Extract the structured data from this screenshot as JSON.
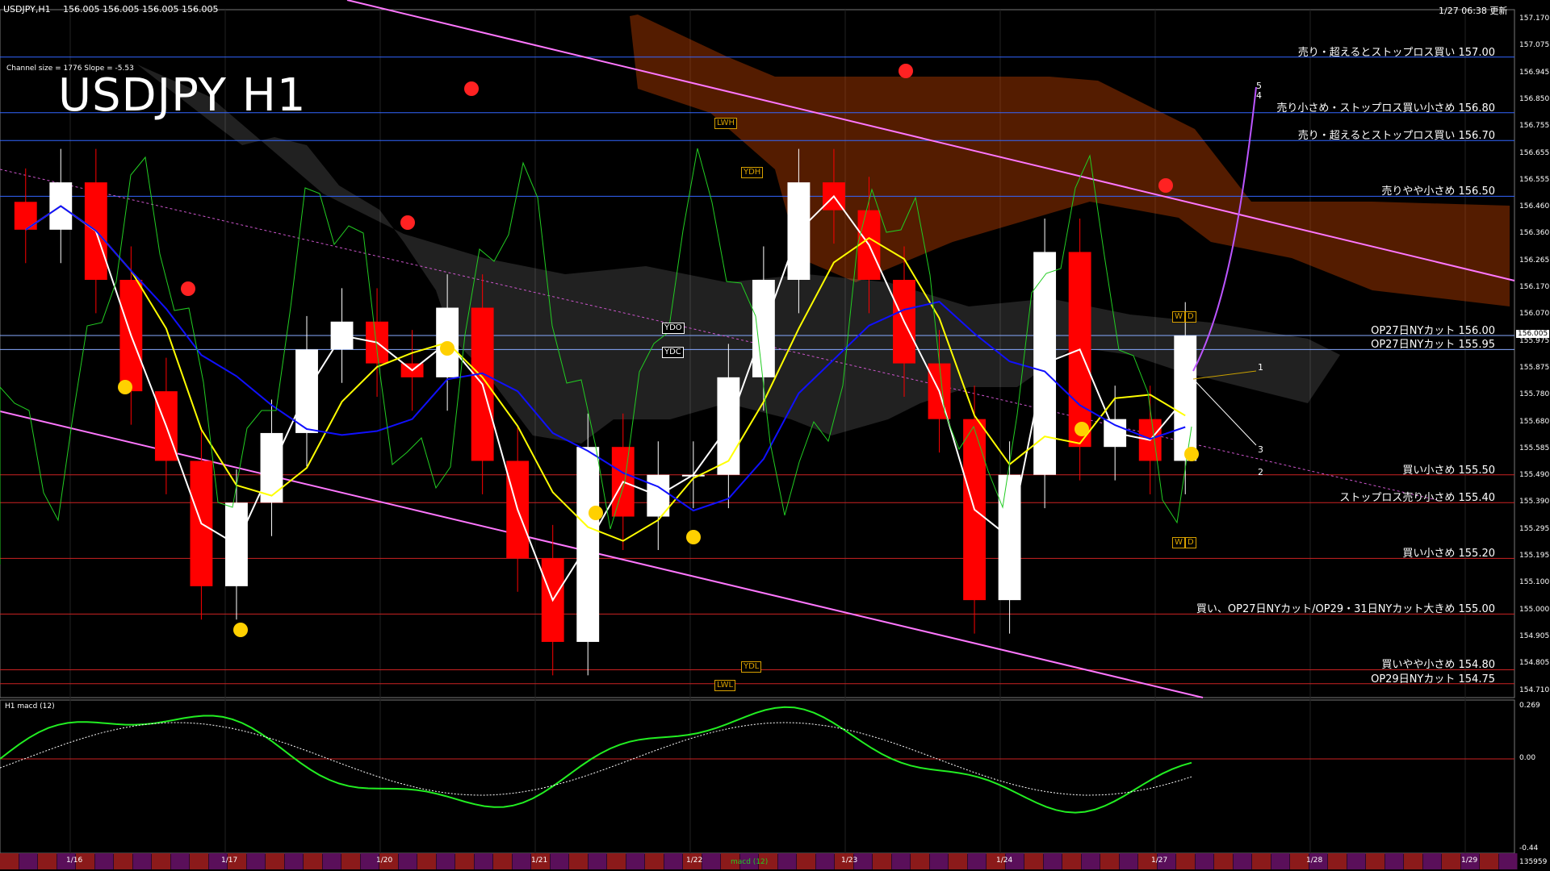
{
  "header": {
    "symbol_info": "USDJPY,H1",
    "ohlc": "156.005 156.005 156.005 156.005",
    "updated": "1/27 06:38 更新",
    "channel_info": "Channel size = 1776 Slope = -5.53"
  },
  "title": "USDJPY H1",
  "colors": {
    "background": "#000000",
    "bull_candle": "#ffffff",
    "bear_candle": "#ff0000",
    "ichimoku_cloud": "#ff5500",
    "trend_channel": "#ff77ff",
    "ma_white": "#ffffff",
    "ma_yellow": "#ffff00",
    "ma_blue": "#1010ff",
    "oscillator": "#22cc22",
    "resistance_line": "#3366ff",
    "support_line": "#cc2222"
  },
  "level_annotations": [
    {
      "text": "売り・超えるとストップロス買い 157.00",
      "price": 157.0,
      "kind": "resistance"
    },
    {
      "text": "売り小さめ・ストップロス買い小さめ 156.80",
      "price": 156.8,
      "kind": "resistance"
    },
    {
      "text": "売り・超えるとストップロス買い 156.70",
      "price": 156.7,
      "kind": "resistance"
    },
    {
      "text": "売りやや小さめ 156.50",
      "price": 156.5,
      "kind": "resistance"
    },
    {
      "text": "OP27日NYカット 156.00",
      "price": 156.0,
      "kind": "option"
    },
    {
      "text": "OP27日NYカット 155.95",
      "price": 155.95,
      "kind": "option"
    },
    {
      "text": "買い小さめ 155.50",
      "price": 155.5,
      "kind": "support"
    },
    {
      "text": "ストップロス売り小さめ 155.40",
      "price": 155.4,
      "kind": "support"
    },
    {
      "text": "買い小さめ 155.20",
      "price": 155.2,
      "kind": "support"
    },
    {
      "text": "買い、OP27日NYカット/OP29・31日NYカット大きめ 155.00",
      "price": 155.0,
      "kind": "support"
    },
    {
      "text": "買いやや小さめ 154.80",
      "price": 154.8,
      "kind": "support"
    },
    {
      "text": "OP29日NYカット 154.75",
      "price": 154.75,
      "kind": "support"
    }
  ],
  "price_axis_ticks": [
    "157.170",
    "157.075",
    "156.945",
    "156.850",
    "156.755",
    "156.655",
    "156.555",
    "156.460",
    "156.360",
    "156.265",
    "156.170",
    "156.070",
    "155.975",
    "155.875",
    "155.780",
    "155.680",
    "155.585",
    "155.490",
    "155.390",
    "155.295",
    "155.195",
    "155.100",
    "155.000",
    "154.905",
    "154.805",
    "154.710"
  ],
  "current_price": "156.005",
  "date_ticks": [
    "1/16",
    "1/17",
    "1/20",
    "1/21",
    "1/22",
    "1/23",
    "1/24",
    "1/27",
    "1/28",
    "1/29"
  ],
  "tags": {
    "ydo": "YDO",
    "ydc": "YDC",
    "ydh": "YDH",
    "ydl": "YDL",
    "lwh": "LWH",
    "lwl": "LWL",
    "w": "W",
    "d": "D"
  },
  "wave_labels": [
    "5",
    "4",
    "1",
    "3",
    "2"
  ],
  "macd": {
    "label": "H1 macd (12)",
    "scale_top": "0.269",
    "scale_zero": "0.00",
    "scale_bottom": "-0.44",
    "bottom_status": "macd (12)",
    "bottom_value": "135959"
  },
  "chart_data": {
    "type": "candlestick",
    "title": "USDJPY H1",
    "ylim": [
      154.7,
      157.17
    ],
    "x_labels": [
      "1/16",
      "1/17",
      "1/20",
      "1/21",
      "1/22",
      "1/23",
      "1/24",
      "1/27",
      "1/28",
      "1/29"
    ],
    "series": [
      {
        "name": "USDJPY H1 close (approx)",
        "values": [
          156.38,
          156.55,
          156.2,
          155.8,
          155.55,
          155.1,
          155.4,
          155.65,
          155.95,
          156.05,
          155.9,
          155.85,
          156.1,
          155.55,
          155.2,
          154.9,
          155.6,
          155.35,
          155.5,
          155.5,
          155.85,
          156.2,
          156.55,
          156.45,
          156.2,
          155.9,
          155.7,
          155.05,
          155.5,
          156.3,
          155.6,
          155.7,
          155.55,
          156.0
        ]
      }
    ],
    "levels": [
      157.0,
      156.8,
      156.7,
      156.5,
      156.0,
      155.95,
      155.5,
      155.4,
      155.2,
      155.0,
      154.8,
      154.75
    ]
  }
}
